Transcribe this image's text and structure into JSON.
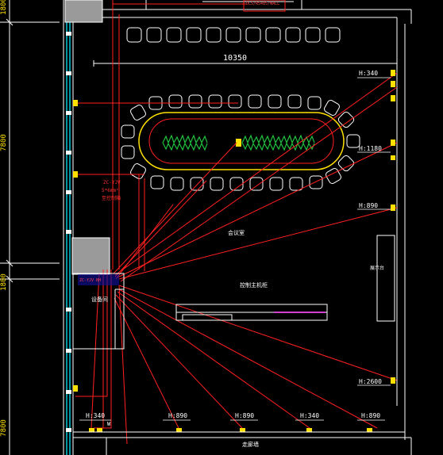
{
  "drawing": {
    "dimension_top": "10350",
    "side_dimensions": [
      "7800",
      "1800",
      "7800"
    ],
    "height_labels": {
      "right_top": "H:340",
      "right_mid": "H:1180",
      "right_low": "H:890",
      "right_bottom": "H:2600",
      "bottom": [
        "H:340",
        "H:890",
        "H:890",
        "H:340",
        "H:890"
      ]
    },
    "cable_note": [
      "ZC-YJV",
      "5*6mm²",
      "至控制箱"
    ],
    "room_labels": {
      "meeting_room": "会议室",
      "equipment_room": "设备间",
      "control_desk": "控制主机柜",
      "side_cabinet": "展示台",
      "corridor": "走廊墙",
      "w_mark": "W"
    },
    "top_note": "DLS/RS485/WALL",
    "colors": {
      "background": "#000000",
      "walls": "#ffffff",
      "cables": "#ff2020",
      "cyan_wall": "#00c8d8",
      "yellow": "#ffe000",
      "plant": "#20c040",
      "magenta": "#d040d0",
      "gray_box": "#9a9a9a"
    }
  }
}
